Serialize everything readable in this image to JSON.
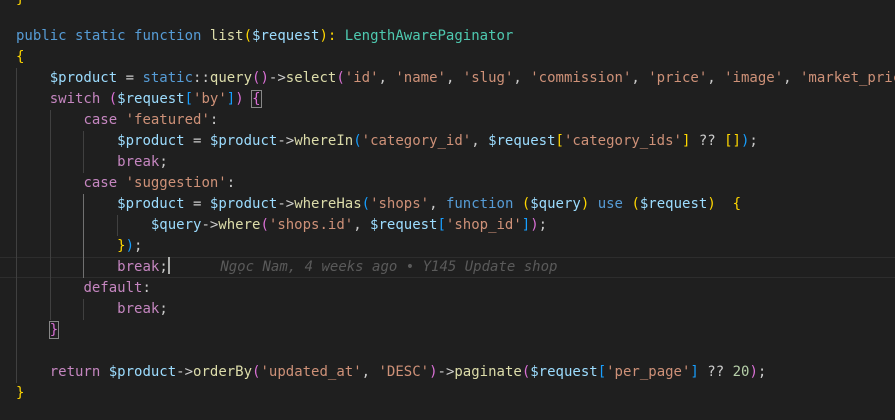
{
  "colors": {
    "background": "#1f1f1f",
    "keyword": "#569cd6",
    "control": "#c586c0",
    "function": "#dcdcaa",
    "variable": "#9cdcfe",
    "string": "#ce9178",
    "type": "#4ec9b0",
    "number": "#b5cea8",
    "punctuation": "#cccccc",
    "bracket_gold": "#ffd700",
    "bracket_pink": "#da70d6",
    "bracket_blue": "#179fff",
    "blame": "#5a5a5a"
  },
  "top_fragment": "}",
  "blame": "Ngọc Nam, 4 weeks ago • Y145 Update shop",
  "lines": [
    [
      [
        "public ",
        "keyword"
      ],
      [
        "static ",
        "keyword"
      ],
      [
        "function ",
        "keyword"
      ],
      [
        "list",
        "function"
      ],
      [
        "(",
        "bracket_gold"
      ],
      [
        "$request",
        "variable"
      ],
      [
        "): ",
        "bracket_gold"
      ],
      [
        "LengthAwarePaginator",
        "type"
      ]
    ],
    [
      [
        "{",
        "bracket_gold"
      ]
    ],
    [
      [
        "    ",
        "punctuation"
      ],
      [
        "$product",
        "variable"
      ],
      [
        " = ",
        "punctuation"
      ],
      [
        "static",
        "keyword"
      ],
      [
        "::",
        "punctuation"
      ],
      [
        "query",
        "function"
      ],
      [
        "()",
        "bracket_pink"
      ],
      [
        "->",
        "punctuation"
      ],
      [
        "select",
        "function"
      ],
      [
        "(",
        "bracket_pink"
      ],
      [
        "'id'",
        "string"
      ],
      [
        ", ",
        "punctuation"
      ],
      [
        "'name'",
        "string"
      ],
      [
        ", ",
        "punctuation"
      ],
      [
        "'slug'",
        "string"
      ],
      [
        ", ",
        "punctuation"
      ],
      [
        "'commission'",
        "string"
      ],
      [
        ", ",
        "punctuation"
      ],
      [
        "'price'",
        "string"
      ],
      [
        ", ",
        "punctuation"
      ],
      [
        "'image'",
        "string"
      ],
      [
        ", ",
        "punctuation"
      ],
      [
        "'market_price'",
        "string"
      ]
    ],
    [
      [
        "    ",
        "punctuation"
      ],
      [
        "switch",
        "control"
      ],
      [
        " ",
        "punctuation"
      ],
      [
        "(",
        "bracket_pink"
      ],
      [
        "$request",
        "variable"
      ],
      [
        "[",
        "bracket_blue"
      ],
      [
        "'by'",
        "string"
      ],
      [
        "]",
        "bracket_blue"
      ],
      [
        ")",
        "bracket_pink"
      ],
      [
        " ",
        "punctuation"
      ],
      [
        "{",
        "bracket_pink"
      ]
    ],
    [
      [
        "        ",
        "punctuation"
      ],
      [
        "case",
        "control"
      ],
      [
        " ",
        "punctuation"
      ],
      [
        "'featured'",
        "string"
      ],
      [
        ":",
        "punctuation"
      ]
    ],
    [
      [
        "            ",
        "punctuation"
      ],
      [
        "$product",
        "variable"
      ],
      [
        " = ",
        "punctuation"
      ],
      [
        "$product",
        "variable"
      ],
      [
        "->",
        "punctuation"
      ],
      [
        "whereIn",
        "function"
      ],
      [
        "(",
        "bracket_blue"
      ],
      [
        "'category_id'",
        "string"
      ],
      [
        ", ",
        "punctuation"
      ],
      [
        "$request",
        "variable"
      ],
      [
        "[",
        "bracket_gold"
      ],
      [
        "'category_ids'",
        "string"
      ],
      [
        "]",
        "bracket_gold"
      ],
      [
        " ?? ",
        "punctuation"
      ],
      [
        "[]",
        "bracket_gold"
      ],
      [
        ")",
        "bracket_blue"
      ],
      [
        ";",
        "punctuation"
      ]
    ],
    [
      [
        "            ",
        "punctuation"
      ],
      [
        "break",
        "control"
      ],
      [
        ";",
        "punctuation"
      ]
    ],
    [
      [
        "        ",
        "punctuation"
      ],
      [
        "case",
        "control"
      ],
      [
        " ",
        "punctuation"
      ],
      [
        "'suggestion'",
        "string"
      ],
      [
        ":",
        "punctuation"
      ]
    ],
    [
      [
        "            ",
        "punctuation"
      ],
      [
        "$product",
        "variable"
      ],
      [
        " = ",
        "punctuation"
      ],
      [
        "$product",
        "variable"
      ],
      [
        "->",
        "punctuation"
      ],
      [
        "whereHas",
        "function"
      ],
      [
        "(",
        "bracket_blue"
      ],
      [
        "'shops'",
        "string"
      ],
      [
        ", ",
        "punctuation"
      ],
      [
        "function",
        "keyword"
      ],
      [
        " ",
        "punctuation"
      ],
      [
        "(",
        "bracket_gold"
      ],
      [
        "$query",
        "variable"
      ],
      [
        ")",
        "bracket_gold"
      ],
      [
        " ",
        "punctuation"
      ],
      [
        "use",
        "keyword"
      ],
      [
        " ",
        "punctuation"
      ],
      [
        "(",
        "bracket_gold"
      ],
      [
        "$request",
        "variable"
      ],
      [
        ")",
        "bracket_gold"
      ],
      [
        "  ",
        "punctuation"
      ],
      [
        "{",
        "bracket_gold"
      ]
    ],
    [
      [
        "                ",
        "punctuation"
      ],
      [
        "$query",
        "variable"
      ],
      [
        "->",
        "punctuation"
      ],
      [
        "where",
        "function"
      ],
      [
        "(",
        "bracket_pink"
      ],
      [
        "'shops.id'",
        "string"
      ],
      [
        ", ",
        "punctuation"
      ],
      [
        "$request",
        "variable"
      ],
      [
        "[",
        "bracket_blue"
      ],
      [
        "'shop_id'",
        "string"
      ],
      [
        "]",
        "bracket_blue"
      ],
      [
        ")",
        "bracket_pink"
      ],
      [
        ";",
        "punctuation"
      ]
    ],
    [
      [
        "            ",
        "punctuation"
      ],
      [
        "}",
        "bracket_gold"
      ],
      [
        ")",
        "bracket_blue"
      ],
      [
        ";",
        "punctuation"
      ]
    ],
    [
      [
        "            ",
        "punctuation"
      ],
      [
        "break",
        "control"
      ],
      [
        ";",
        "punctuation"
      ]
    ],
    [
      [
        "        ",
        "punctuation"
      ],
      [
        "default",
        "control"
      ],
      [
        ":",
        "punctuation"
      ]
    ],
    [
      [
        "            ",
        "punctuation"
      ],
      [
        "break",
        "control"
      ],
      [
        ";",
        "punctuation"
      ]
    ],
    [
      [
        "    ",
        "punctuation"
      ],
      [
        "}",
        "bracket_pink"
      ]
    ],
    [],
    [
      [
        "    ",
        "punctuation"
      ],
      [
        "return",
        "control"
      ],
      [
        " ",
        "punctuation"
      ],
      [
        "$product",
        "variable"
      ],
      [
        "->",
        "punctuation"
      ],
      [
        "orderBy",
        "function"
      ],
      [
        "(",
        "bracket_pink"
      ],
      [
        "'updated_at'",
        "string"
      ],
      [
        ", ",
        "punctuation"
      ],
      [
        "'DESC'",
        "string"
      ],
      [
        ")",
        "bracket_pink"
      ],
      [
        "->",
        "punctuation"
      ],
      [
        "paginate",
        "function"
      ],
      [
        "(",
        "bracket_pink"
      ],
      [
        "$request",
        "variable"
      ],
      [
        "[",
        "bracket_blue"
      ],
      [
        "'per_page'",
        "string"
      ],
      [
        "]",
        "bracket_blue"
      ],
      [
        " ?? ",
        "punctuation"
      ],
      [
        "20",
        "number"
      ],
      [
        ")",
        "bracket_pink"
      ],
      [
        ";",
        "punctuation"
      ]
    ],
    [
      [
        "}",
        "bracket_gold"
      ]
    ]
  ]
}
